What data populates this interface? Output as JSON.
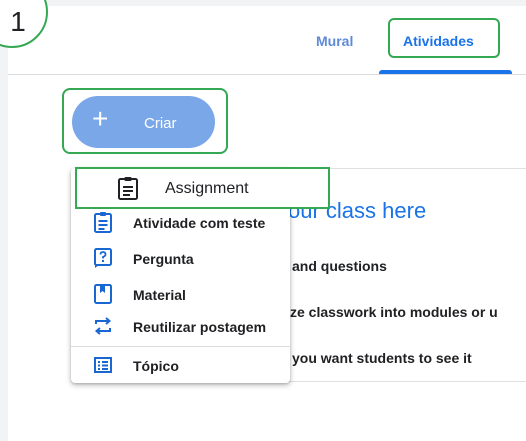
{
  "step_badge": {
    "number": "1"
  },
  "tabs": [
    {
      "label": "Mural"
    },
    {
      "label": "Atividades",
      "selected": true
    }
  ],
  "create_button": {
    "label": "Criar",
    "icon": "plus-icon"
  },
  "background_card": {
    "title_fragment": "our class here",
    "lines": [
      "and questions",
      "ze classwork into modules or u",
      "you want students to see it"
    ]
  },
  "menu": {
    "highlighted": {
      "label": "Assignment",
      "icon": "assignment-icon"
    },
    "items": [
      {
        "label": "Atividade com teste",
        "icon": "quiz-assignment-icon"
      },
      {
        "label": "Pergunta",
        "icon": "question-icon"
      },
      {
        "label": "Material",
        "icon": "material-icon"
      },
      {
        "label": "Reutilizar postagem",
        "icon": "reuse-post-icon"
      },
      {
        "label": "Tópico",
        "icon": "topic-icon"
      }
    ]
  },
  "colors": {
    "accent": "#1a73e8",
    "highlight": "#34a853",
    "create_button": "#7aa7e8",
    "icon": "#1967d2"
  }
}
